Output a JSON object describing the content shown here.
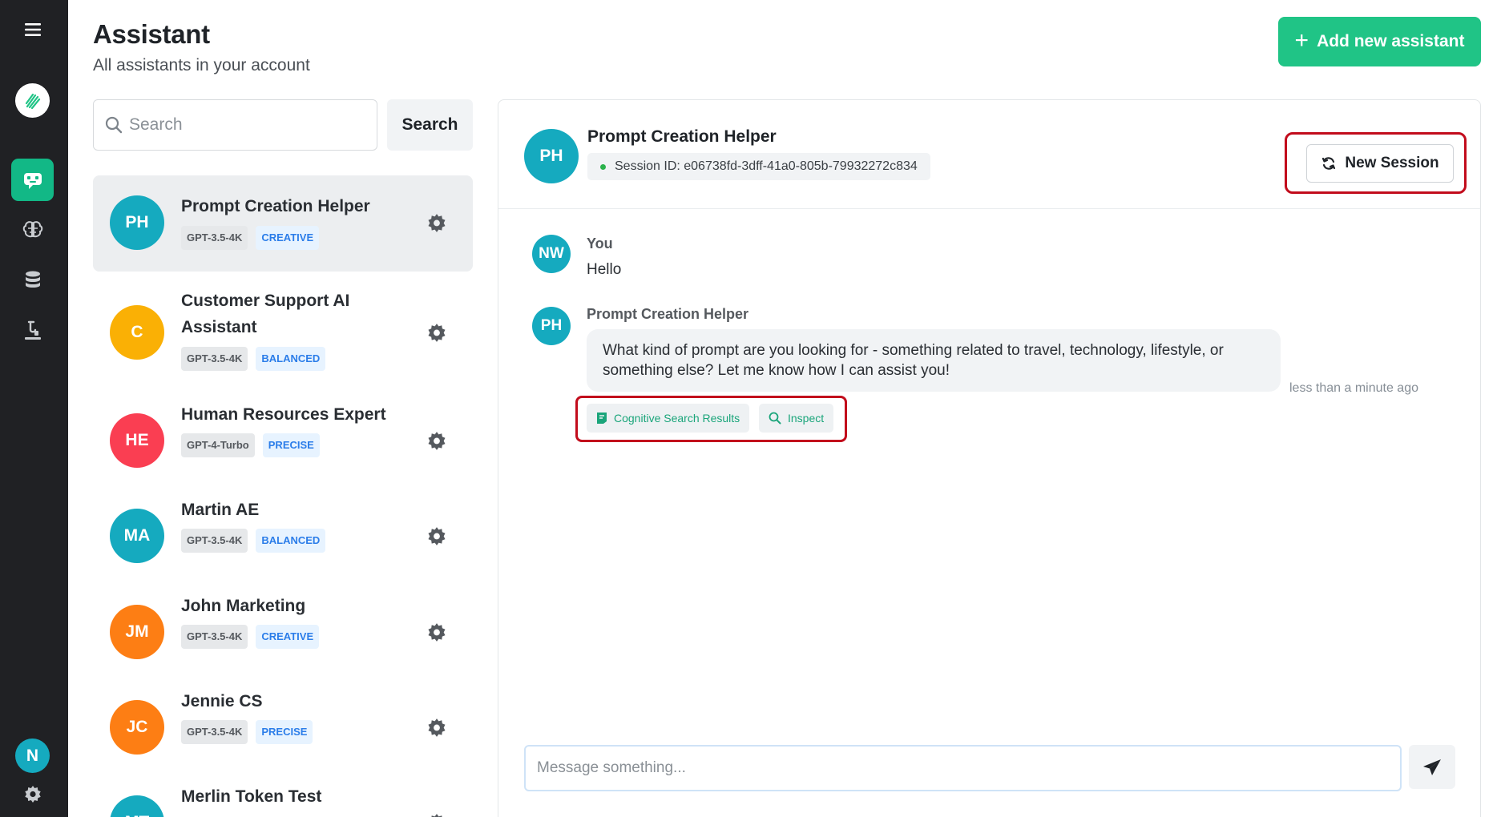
{
  "colors": {
    "accent": "#20c486",
    "rail_bg": "#202124",
    "highlight_outline": "#c20c1c",
    "tag_mode_text": "#2b7de9"
  },
  "rail": {
    "items": [
      {
        "icon": "menu-icon"
      },
      {
        "icon": "logo-icon"
      },
      {
        "icon": "assistant-icon",
        "active": true
      },
      {
        "icon": "brain-icon"
      },
      {
        "icon": "database-icon"
      },
      {
        "icon": "lab-icon"
      }
    ],
    "user_initial": "N",
    "settings_icon": "gear-icon"
  },
  "header": {
    "title": "Assistant",
    "subtitle": "All assistants in your account",
    "add_button_label": "Add new assistant"
  },
  "search": {
    "placeholder": "Search",
    "button_label": "Search"
  },
  "assistants": [
    {
      "initials": "PH",
      "name": "Prompt Creation Helper",
      "model": "GPT-3.5-4K",
      "mode": "CREATIVE",
      "color": "#15aabf",
      "selected": true
    },
    {
      "initials": "C",
      "name": "Customer Support AI Assistant",
      "model": "GPT-3.5-4K",
      "mode": "BALANCED",
      "color": "#fab005"
    },
    {
      "initials": "HE",
      "name": "Human Resources Expert",
      "model": "GPT-4-Turbo",
      "mode": "PRECISE",
      "color": "#fa3e52"
    },
    {
      "initials": "MA",
      "name": "Martin AE",
      "model": "GPT-3.5-4K",
      "mode": "BALANCED",
      "color": "#15aabf"
    },
    {
      "initials": "JM",
      "name": "John Marketing",
      "model": "GPT-3.5-4K",
      "mode": "CREATIVE",
      "color": "#fd7e14"
    },
    {
      "initials": "JC",
      "name": "Jennie CS",
      "model": "GPT-3.5-4K",
      "mode": "PRECISE",
      "color": "#fd7e14"
    },
    {
      "initials": "MT",
      "name": "Merlin Token Test",
      "model": "",
      "mode": "",
      "color": "#15aabf"
    }
  ],
  "chat": {
    "assistant_initials": "PH",
    "assistant_name": "Prompt Creation Helper",
    "session_id": "Session ID: e06738fd-3dff-41a0-805b-79932272c834",
    "new_session_label": "New Session",
    "messages": [
      {
        "initials": "NW",
        "author": "You",
        "text": "Hello"
      },
      {
        "initials": "PH",
        "author": "Prompt Creation Helper",
        "text": "What kind of prompt are you looking for - something related to travel, technology, lifestyle, or something else? Let me know how I can assist you!",
        "timestamp": "less than a minute ago"
      }
    ],
    "actions": {
      "cognitive_search": "Cognitive Search Results",
      "inspect": "Inspect"
    },
    "composer_placeholder": "Message something..."
  }
}
